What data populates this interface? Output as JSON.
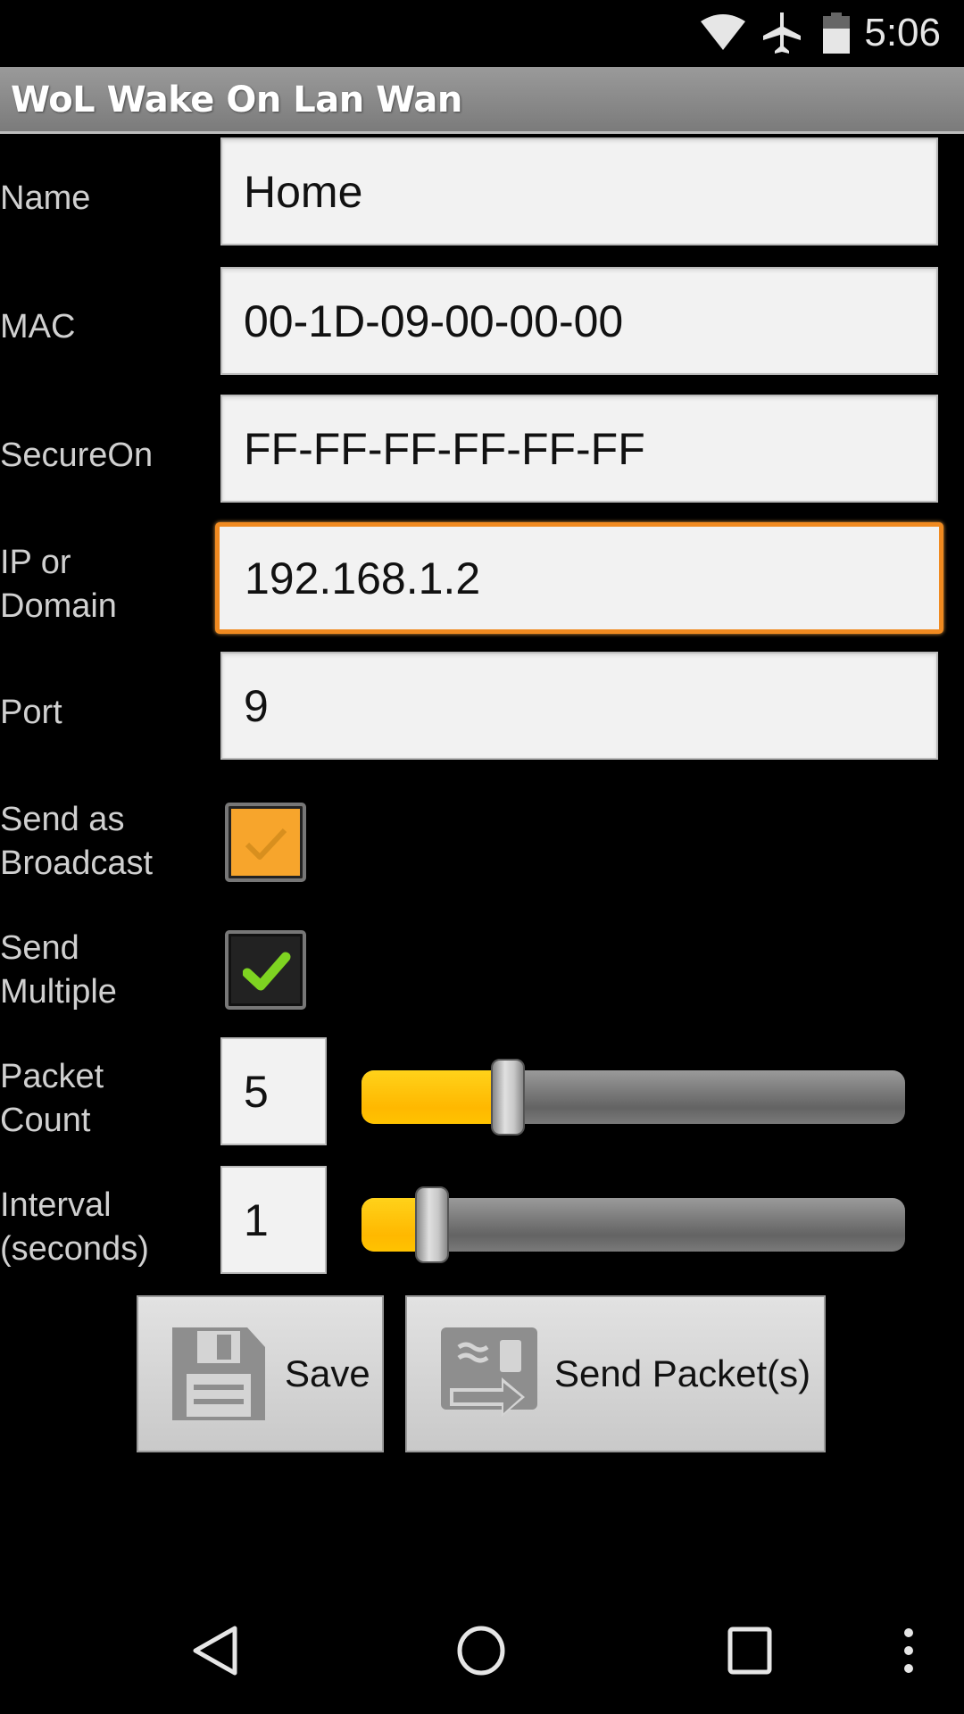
{
  "status_bar": {
    "time": "5:06",
    "icons": [
      "wifi-icon",
      "airplane-mode-icon",
      "battery-icon"
    ]
  },
  "app": {
    "title": "WoL Wake On Lan Wan"
  },
  "form": {
    "name": {
      "label": "Name",
      "value": "Home"
    },
    "mac": {
      "label": "MAC",
      "value": "00-1D-09-00-00-00"
    },
    "secureon": {
      "label": "SecureOn",
      "value": "FF-FF-FF-FF-FF-FF"
    },
    "ip": {
      "label_line1": "IP or",
      "label_line2": "Domain",
      "value": "192.168.1.2",
      "focused": true
    },
    "port": {
      "label": "Port",
      "value": "9"
    },
    "broadcast": {
      "label_line1": "Send as",
      "label_line2": "Broadcast",
      "checked": false
    },
    "multiple": {
      "label_line1": "Send",
      "label_line2": "Multiple",
      "checked": true
    },
    "packet_count": {
      "label_line1": "Packet",
      "label_line2": "Count",
      "value": "5",
      "slider_fraction": 0.27
    },
    "interval": {
      "label_line1": "Interval",
      "label_line2": "(seconds)",
      "value": "1",
      "slider_fraction": 0.13
    }
  },
  "buttons": {
    "save": {
      "label": "Save",
      "icon": "floppy-disk-icon"
    },
    "send": {
      "label": "Send Packet(s)",
      "icon": "send-packet-icon"
    }
  },
  "nav_bar": {
    "icons": [
      "back-icon",
      "home-icon",
      "recents-icon",
      "overflow-menu-icon"
    ]
  },
  "colors": {
    "accent_focus": "#f08a20",
    "slider_fill": "#ffc300",
    "checkmark_green": "#7ed321",
    "checkbox_orange": "#f7a52c"
  }
}
